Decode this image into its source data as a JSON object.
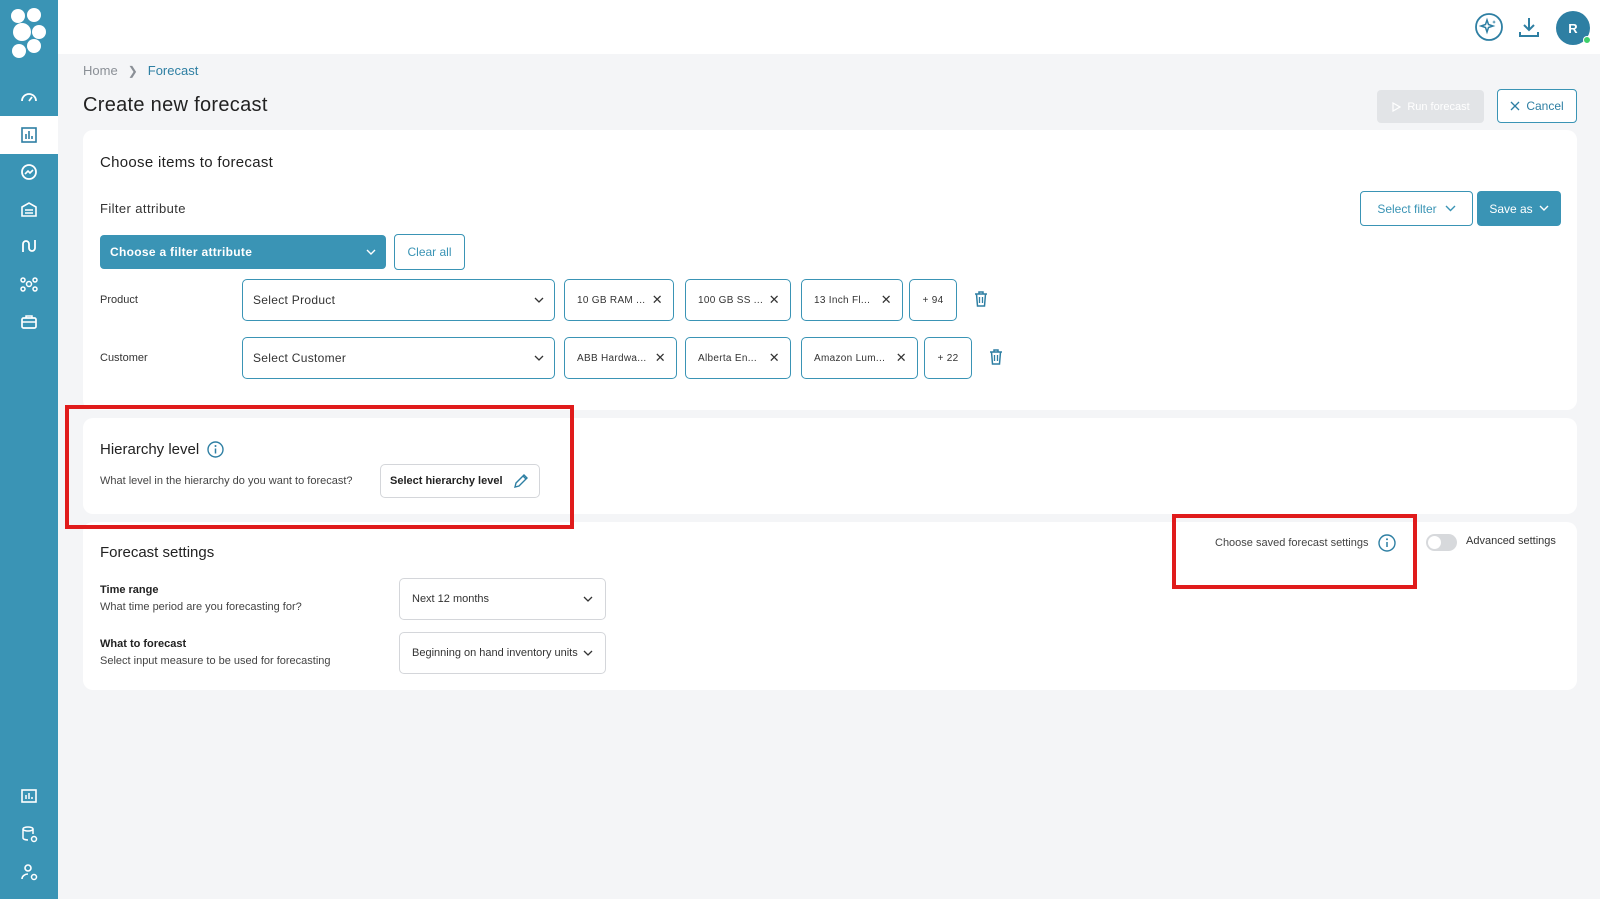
{
  "topbar": {
    "avatar_initial": "R",
    "icons": [
      "sparkle-assistant-icon",
      "download-icon"
    ]
  },
  "sidebar": {
    "items": [
      {
        "icon": "dashboard-gauge-icon"
      },
      {
        "icon": "bar-chart-icon",
        "active": true
      },
      {
        "icon": "trend-circle-icon"
      },
      {
        "icon": "warehouse-icon"
      },
      {
        "icon": "route-icon"
      },
      {
        "icon": "network-icon"
      },
      {
        "icon": "briefcase-icon"
      },
      {
        "icon": "report-icon"
      },
      {
        "icon": "database-settings-icon"
      },
      {
        "icon": "user-settings-icon"
      }
    ]
  },
  "breadcrumb": {
    "home": "Home",
    "current": "Forecast"
  },
  "page": {
    "title": "Create new forecast",
    "run_label": "Run forecast",
    "cancel_label": "Cancel"
  },
  "items_card": {
    "title": "Choose items to forecast",
    "filter_label": "Filter attribute",
    "select_filter_label": "Select filter",
    "save_as_label": "Save as",
    "filter_dropdown_label": "Choose a filter attribute",
    "clear_all_label": "Clear all",
    "rows": [
      {
        "label": "Product",
        "placeholder": "Select Product",
        "chips": [
          "10 GB RAM ...",
          "100 GB SS ...",
          "13 Inch Fl..."
        ],
        "more": "+ 94"
      },
      {
        "label": "Customer",
        "placeholder": "Select Customer",
        "chips": [
          "ABB Hardwa...",
          "Alberta En...",
          "Amazon Lum..."
        ],
        "more": "+ 22"
      }
    ]
  },
  "hierarchy": {
    "title": "Hierarchy level",
    "question": "What level in the hierarchy do you want to forecast?",
    "button_label": "Select hierarchy level"
  },
  "forecast_settings": {
    "title": "Forecast settings",
    "saved_settings_label": "Choose saved forecast settings",
    "advanced_label": "Advanced settings",
    "advanced_enabled": false,
    "time_range": {
      "title": "Time range",
      "sub": "What time period are you forecasting for?",
      "value": "Next 12 months"
    },
    "what_to_forecast": {
      "title": "What to forecast",
      "sub": "Select input measure to be used for forecasting",
      "value": "Beginning on hand inventory units"
    }
  },
  "colors": {
    "accent": "#3a94b5",
    "highlight": "#e01b1b",
    "disabled": "#e2e4e7"
  }
}
